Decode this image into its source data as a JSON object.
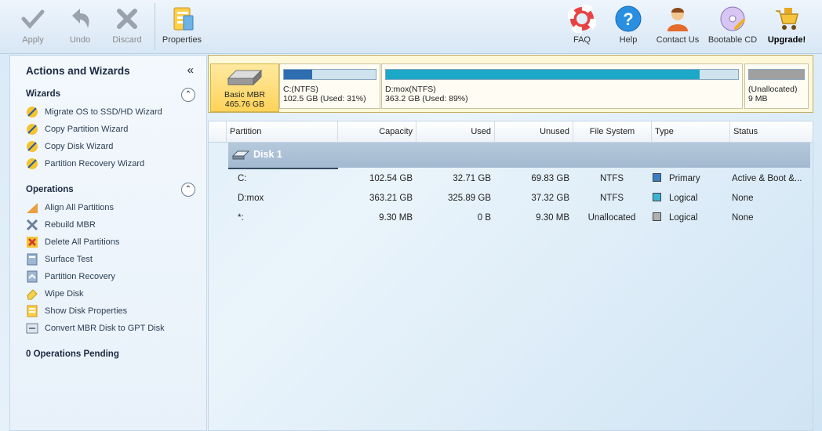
{
  "toolbar": {
    "left_buttons": [
      {
        "label": "Apply",
        "icon": "check-icon"
      },
      {
        "label": "Undo",
        "icon": "undo-arrow-icon"
      },
      {
        "label": "Discard",
        "icon": "discard-x-icon"
      },
      {
        "label": "Properties",
        "icon": "properties-icon"
      }
    ],
    "right_buttons": [
      {
        "label": "FAQ",
        "icon": "lifebuoy-icon"
      },
      {
        "label": "Help",
        "icon": "help-question-icon"
      },
      {
        "label": "Contact Us",
        "icon": "contact-person-icon"
      },
      {
        "label": "Bootable CD",
        "icon": "cd-icon"
      },
      {
        "label": "Upgrade!",
        "icon": "shopping-cart-icon"
      }
    ]
  },
  "sidebar": {
    "title": "Actions and Wizards",
    "collapse_glyph": "«",
    "wizards": {
      "heading": "Wizards",
      "items": [
        "Migrate OS to SSD/HD Wizard",
        "Copy Partition Wizard",
        "Copy Disk Wizard",
        "Partition Recovery Wizard"
      ]
    },
    "operations": {
      "heading": "Operations",
      "items": [
        "Align All Partitions",
        "Rebuild MBR",
        "Delete All Partitions",
        "Surface Test",
        "Partition Recovery",
        "Wipe Disk",
        "Show Disk Properties",
        "Convert MBR Disk to GPT Disk"
      ]
    },
    "pending": "0 Operations Pending"
  },
  "disk_map": {
    "disk": {
      "line1": "Basic MBR",
      "line2": "465.76 GB"
    },
    "partitions": [
      {
        "line1": "C:(NTFS)",
        "line2": "102.5 GB (Used: 31%)",
        "used_fraction": 0.31,
        "color": "#2f6db1"
      },
      {
        "line1": "D:mox(NTFS)",
        "line2": "363.2 GB (Used: 89%)",
        "used_fraction": 0.89,
        "color": "#1ba9c7"
      },
      {
        "line1": "(Unallocated)",
        "line2": "9 MB",
        "used_fraction": 0,
        "color": "#a0a0a0"
      }
    ]
  },
  "table": {
    "headers": [
      "Partition",
      "Capacity",
      "Used",
      "Unused",
      "File System",
      "Type",
      "Status"
    ],
    "disk_label": "Disk 1",
    "rows": [
      {
        "partition": "C:",
        "capacity": "102.54 GB",
        "used": "32.71 GB",
        "unused": "69.83 GB",
        "fs": "NTFS",
        "type": "Primary",
        "type_color": "#3a7fc4",
        "status": "Active & Boot &..."
      },
      {
        "partition": "D:mox",
        "capacity": "363.21 GB",
        "used": "325.89 GB",
        "unused": "37.32 GB",
        "fs": "NTFS",
        "type": "Logical",
        "type_color": "#3bb3d6",
        "status": "None"
      },
      {
        "partition": "*:",
        "capacity": "9.30 MB",
        "used": "0 B",
        "unused": "9.30 MB",
        "fs": "Unallocated",
        "type": "Logical",
        "type_color": "#b0b0b0",
        "status": "None"
      }
    ]
  }
}
